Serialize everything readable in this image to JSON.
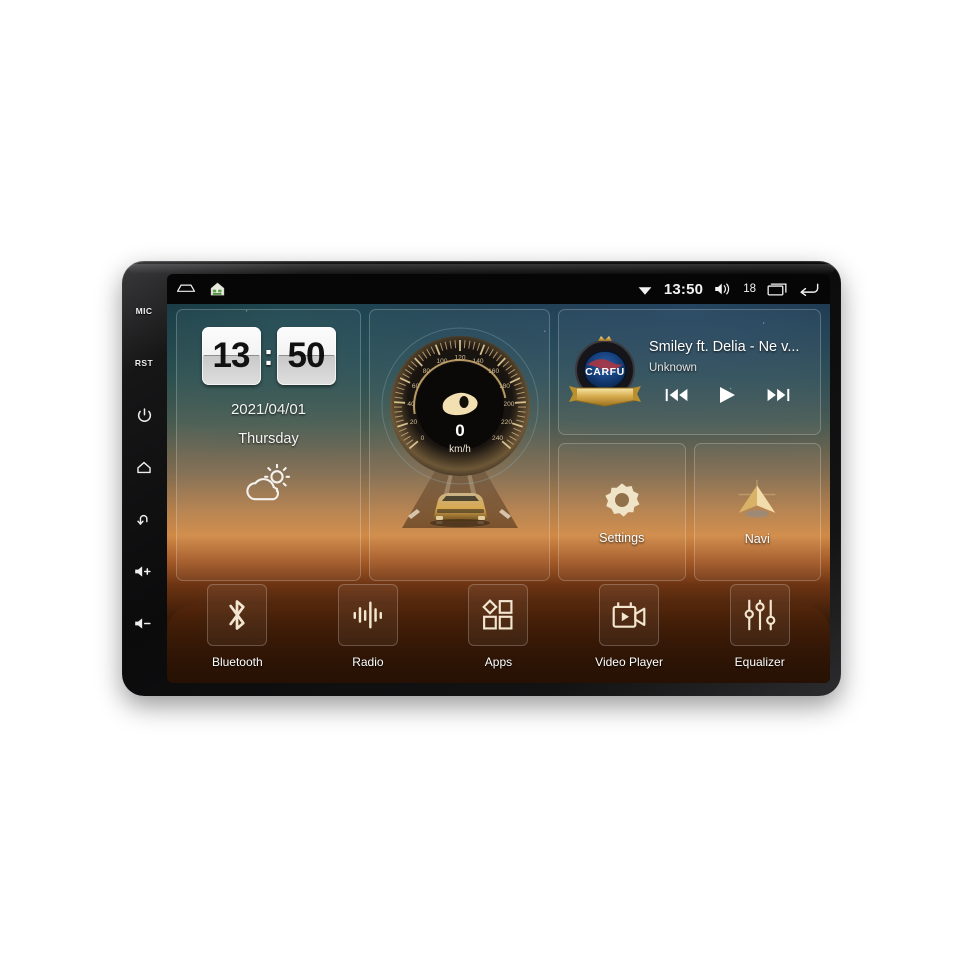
{
  "device": {
    "name": "car-head-unit",
    "hardware_buttons": [
      {
        "id": "mic-button",
        "label": "MIC",
        "type": "text"
      },
      {
        "id": "reset-button",
        "label": "RST",
        "type": "text"
      },
      {
        "id": "power-button",
        "label": "",
        "type": "power-icon"
      },
      {
        "id": "home-button",
        "label": "",
        "type": "home-icon"
      },
      {
        "id": "back-button",
        "label": "",
        "type": "back-icon"
      },
      {
        "id": "volume-up-button",
        "label": "+",
        "type": "volume-up-icon"
      },
      {
        "id": "volume-down-button",
        "label": "-",
        "type": "volume-down-icon"
      }
    ]
  },
  "statusbar": {
    "left_icons": [
      {
        "name": "home-outline-icon"
      },
      {
        "name": "home-app-icon"
      }
    ],
    "wifi_icon": "wifi-icon",
    "time": "13:50",
    "volume_icon": "volume-icon",
    "volume_level": "18",
    "recents_icon": "recents-icon",
    "back_icon": "back-arrow-icon"
  },
  "clock_widget": {
    "hours": "13",
    "minutes": "50",
    "separator": ":",
    "date": "2021/04/01",
    "weekday": "Thursday",
    "weather_icon": "partly-cloudy-icon"
  },
  "speedometer": {
    "value": "0",
    "unit": "km/h",
    "ticks": [
      "0",
      "20",
      "40",
      "60",
      "80",
      "100",
      "120",
      "140",
      "160",
      "180",
      "200",
      "220",
      "240"
    ],
    "min": 0,
    "max": 240,
    "needle_icon": "speed-needle-icon",
    "car_icon": "car-on-road-icon"
  },
  "media": {
    "logo_text": "CARFU",
    "title": "Smiley ft. Delia - Ne v...",
    "artist": "Unknown",
    "controls": [
      {
        "name": "previous-track-button",
        "icon": "previous-icon"
      },
      {
        "name": "play-button",
        "icon": "play-icon"
      },
      {
        "name": "next-track-button",
        "icon": "next-icon"
      }
    ]
  },
  "tiles": [
    {
      "name": "settings-tile",
      "label": "Settings",
      "icon": "gear-icon"
    },
    {
      "name": "navi-tile",
      "label": "Navi",
      "icon": "navigation-arrow-icon"
    }
  ],
  "dock": [
    {
      "name": "bluetooth-app",
      "label": "Bluetooth",
      "icon": "bluetooth-icon"
    },
    {
      "name": "radio-app",
      "label": "Radio",
      "icon": "radio-waveform-icon"
    },
    {
      "name": "apps-app",
      "label": "Apps",
      "icon": "apps-grid-icon"
    },
    {
      "name": "video-player-app",
      "label": "Video Player",
      "icon": "video-camera-icon"
    },
    {
      "name": "equalizer-app",
      "label": "Equalizer",
      "icon": "equalizer-sliders-icon"
    }
  ],
  "colors": {
    "gold": "#e8c98a",
    "screen_dark": "#060607",
    "sunset_orange": "#d08a47",
    "ground_brown": "#3d1d08"
  }
}
